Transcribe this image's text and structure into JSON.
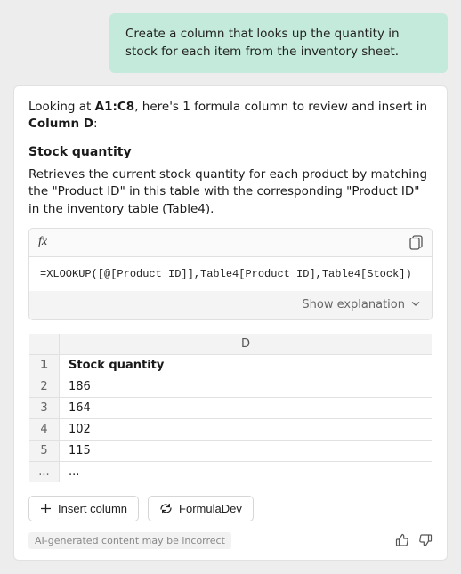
{
  "user_message": "Create a column that looks up the quantity in stock for each item from the inventory sheet.",
  "intro": {
    "prefix": "Looking at ",
    "range": "A1:C8",
    "middle": ", here's 1 formula column to review and insert in ",
    "target": "Column D",
    "suffix": ":"
  },
  "section": {
    "title": "Stock quantity",
    "desc": "Retrieves the current stock quantity for each product by matching the \"Product ID\" in this table with the corresponding \"Product ID\" in the inventory table (Table4)."
  },
  "formula": {
    "fx_label": "fx",
    "code": "=XLOOKUP([@[Product ID]],Table4[Product ID],Table4[Stock])",
    "show_explanation": "Show explanation"
  },
  "preview": {
    "col_label": "D",
    "rows": [
      {
        "n": "1",
        "v": "Stock quantity"
      },
      {
        "n": "2",
        "v": "186"
      },
      {
        "n": "3",
        "v": "164"
      },
      {
        "n": "4",
        "v": "102"
      },
      {
        "n": "5",
        "v": "115"
      },
      {
        "n": "...",
        "v": "..."
      }
    ]
  },
  "actions": {
    "insert": "Insert column",
    "regen": "FormulaDev"
  },
  "disclaimer": "AI-generated content may be incorrect"
}
